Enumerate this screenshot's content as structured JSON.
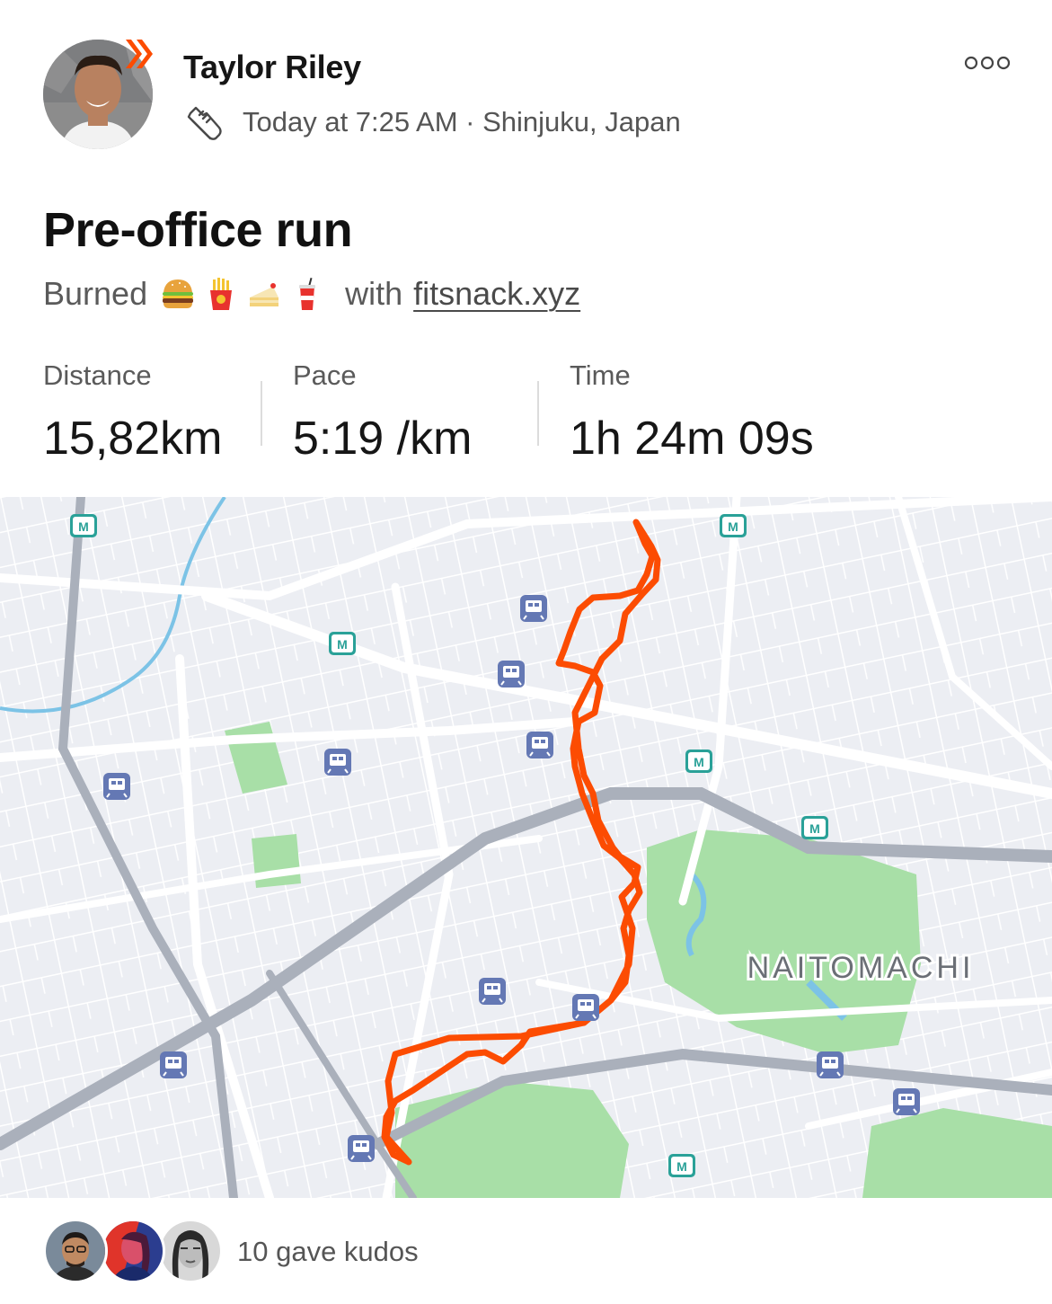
{
  "activity": {
    "athlete_name": "Taylor Riley",
    "timestamp": "Today at 7:25 AM",
    "separator": " · ",
    "location": "Shinjuku, Japan",
    "activity_type_icon": "running-shoe-icon",
    "more_icon": "more-options-icon"
  },
  "title": "Pre-office run",
  "burned": {
    "prefix": "Burned",
    "emojis": [
      "hamburger-icon",
      "fries-icon",
      "cake-icon",
      "soda-icon"
    ],
    "suffix": "with",
    "link_text": "fitsnack.xyz"
  },
  "stats": [
    {
      "label": "Distance",
      "value": "15,82km"
    },
    {
      "label": "Pace",
      "value": "5:19 /km"
    },
    {
      "label": "Time",
      "value": "1h 24m 09s"
    }
  ],
  "map": {
    "area_label": "NAITOMACHI",
    "route_color": "#fc4c02",
    "park_color": "#a8dfa7",
    "road_color": "#ffffff",
    "highway_color": "#aab0bb",
    "station_icon_color": "#6478b4",
    "metro_icon_color": "#2aa198"
  },
  "kudos": {
    "text": "10 gave kudos"
  },
  "colors": {
    "brand": "#fc4c02",
    "text_primary": "#161616",
    "text_secondary": "#5a5a5a"
  }
}
